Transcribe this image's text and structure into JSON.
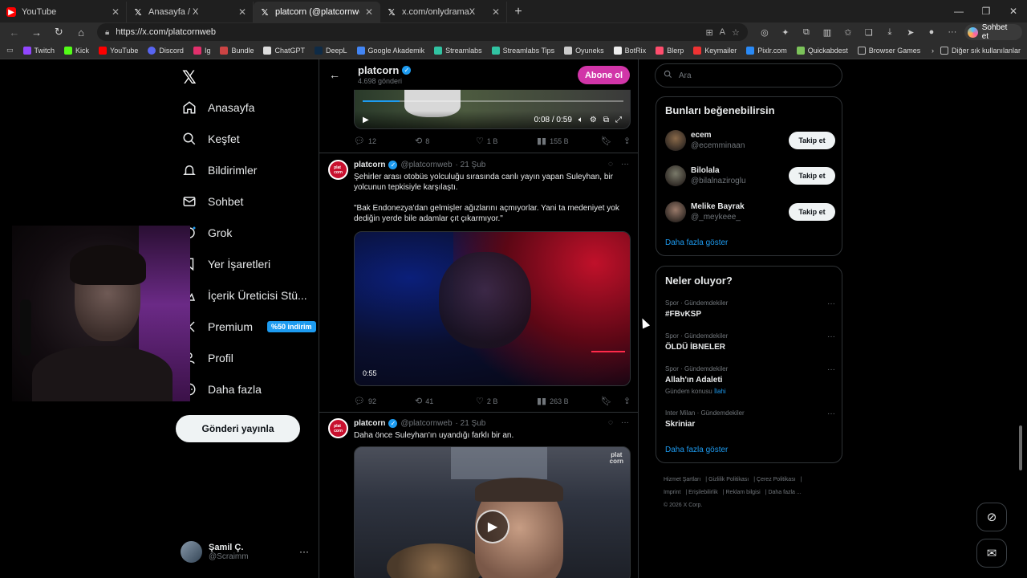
{
  "browser": {
    "tabs": [
      {
        "label": "YouTube",
        "icon": "youtube-icon"
      },
      {
        "label": "Anasayfa / X",
        "icon": "x-icon"
      },
      {
        "label": "platcorn (@platcornweb) / X",
        "icon": "x-icon",
        "active": true
      },
      {
        "label": "x.com/onlydramaX",
        "icon": "x-icon"
      }
    ],
    "url": "https://x.com/platcornweb",
    "copilot_label": "Sohbet et",
    "bookmarks": [
      "Twitch",
      "Kick",
      "YouTube",
      "Discord",
      "Ig",
      "Bundle",
      "ChatGPT",
      "DeepL",
      "Google Akademik",
      "Streamlabs",
      "Streamlabs Tips",
      "Oyuneks",
      "BotRix",
      "Blerp",
      "Keymailer",
      "Pixlr.com",
      "Quickabdest",
      "Browser Games"
    ],
    "other_bookmarks": "Diğer sık kullanılanlar"
  },
  "nav": {
    "items": [
      "Anasayfa",
      "Keşfet",
      "Bildirimler",
      "Sohbet",
      "Grok",
      "Yer İşaretleri",
      "İçerik Üreticisi Stü...",
      "Premium",
      "Profil",
      "Daha fazla"
    ],
    "premium_badge": "%50 indirim",
    "post_button": "Gönderi yayınla",
    "account_name": "Şamil Ç.",
    "account_handle": "@Scraimm"
  },
  "profile": {
    "name": "platcorn",
    "post_count": "4.698 gönderi",
    "subscribe": "Abone ol"
  },
  "post1": {
    "time": "0:08 / 0:59",
    "progress": 0.14,
    "replies": "12",
    "reposts": "8",
    "likes": "1 B",
    "views": "155 B"
  },
  "post2": {
    "name": "platcorn",
    "handle": "@platcornweb",
    "date": "· 21 Şub",
    "text1": "Şehirler arası otobüs yolculuğu sırasında canlı yayın yapan Suleyhan, bir yolcunun tepkisiyle karşılaştı.",
    "text2": "\"Bak Endonezya'dan gelmişler ağızlarını açmıyorlar. Yani ta medeniyet yok dediğin yerde bile adamlar çıt çıkarmıyor.\"",
    "duration": "0:55",
    "replies": "92",
    "reposts": "41",
    "likes": "2 B",
    "views": "263 B"
  },
  "post3": {
    "name": "platcorn",
    "handle": "@platcornweb",
    "date": "· 21 Şub",
    "text": "Daha önce Suleyhan'ın uyandığı farklı bir an."
  },
  "sidebar": {
    "search_placeholder": "Ara",
    "who_title": "Bunları beğenebilirsin",
    "who": [
      {
        "name": "ecem",
        "handle": "@ecemminaan",
        "color": "#8a6a4a"
      },
      {
        "name": "Bilolala",
        "handle": "@bilalnaziroglu",
        "color": "#7a7a6a"
      },
      {
        "name": "Melike Bayrak",
        "handle": "@_meykeee_",
        "color": "#9a7a6a"
      }
    ],
    "follow_label": "Takip et",
    "show_more": "Daha fazla göster",
    "trends_title": "Neler oluyor?",
    "trends": [
      {
        "category": "Spor · Gündemdekiler",
        "title": "#FBvKSP",
        "meta": "",
        "meta_link": ""
      },
      {
        "category": "Spor · Gündemdekiler",
        "title": "ÖLDÜ İBNELER",
        "meta": "",
        "meta_link": ""
      },
      {
        "category": "Spor · Gündemdekiler",
        "title": "Allah'ın Adaleti",
        "meta": "Gündem konusu",
        "meta_link": "İlahi"
      },
      {
        "category": "Inter Milan · Gündemdekiler",
        "title": "Skriniar",
        "meta": "",
        "meta_link": ""
      }
    ],
    "footer": [
      "Hizmet Şartları",
      "Gizlilik Politikası",
      "Çerez Politikası",
      "Imprint",
      "Erişilebilirlik",
      "Reklam bilgisi",
      "Daha fazla ...",
      "© 2026 X Corp."
    ]
  }
}
